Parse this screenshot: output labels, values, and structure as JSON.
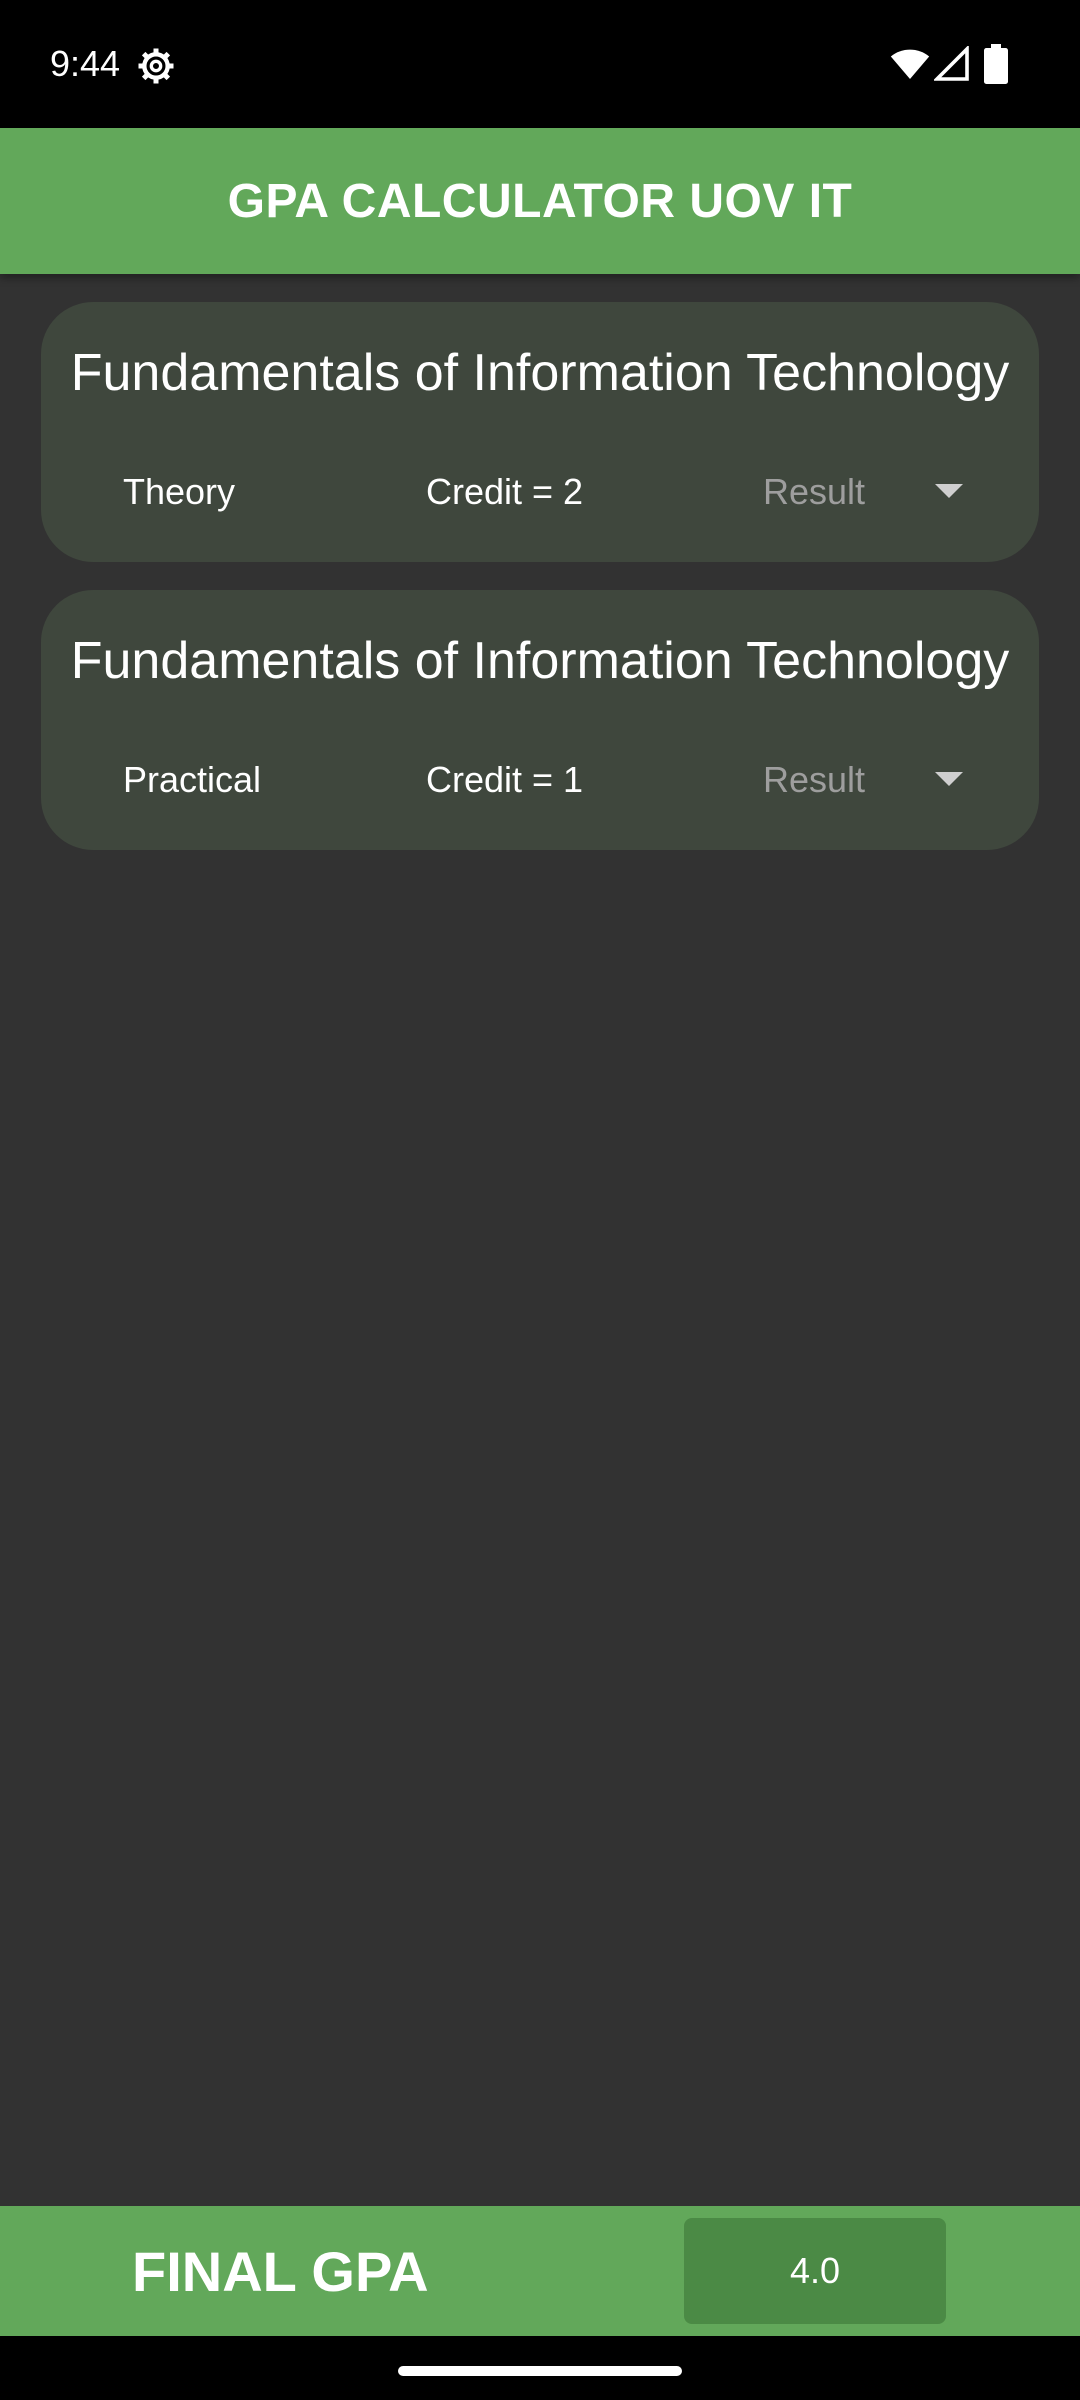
{
  "status_bar": {
    "time": "9:44",
    "icons": [
      "settings-gear-icon",
      "wifi-icon",
      "cell-signal-icon",
      "battery-icon"
    ]
  },
  "app_bar": {
    "title": "GPA CALCULATOR UOV IT",
    "color": "#62a85a"
  },
  "courses": [
    {
      "title": "Fundamentals of Information Technology",
      "type": "Theory",
      "credit": "Credit = 2",
      "result_placeholder": "Result"
    },
    {
      "title": "Fundamentals of Information Technology",
      "type": "Practical",
      "credit": "Credit = 1",
      "result_placeholder": "Result"
    }
  ],
  "footer": {
    "label": "FINAL GPA",
    "value": "4.0"
  },
  "colors": {
    "background": "#323232",
    "card": "#3f473d",
    "accent": "#62a85a",
    "gpa_box": "#4b8a45"
  }
}
